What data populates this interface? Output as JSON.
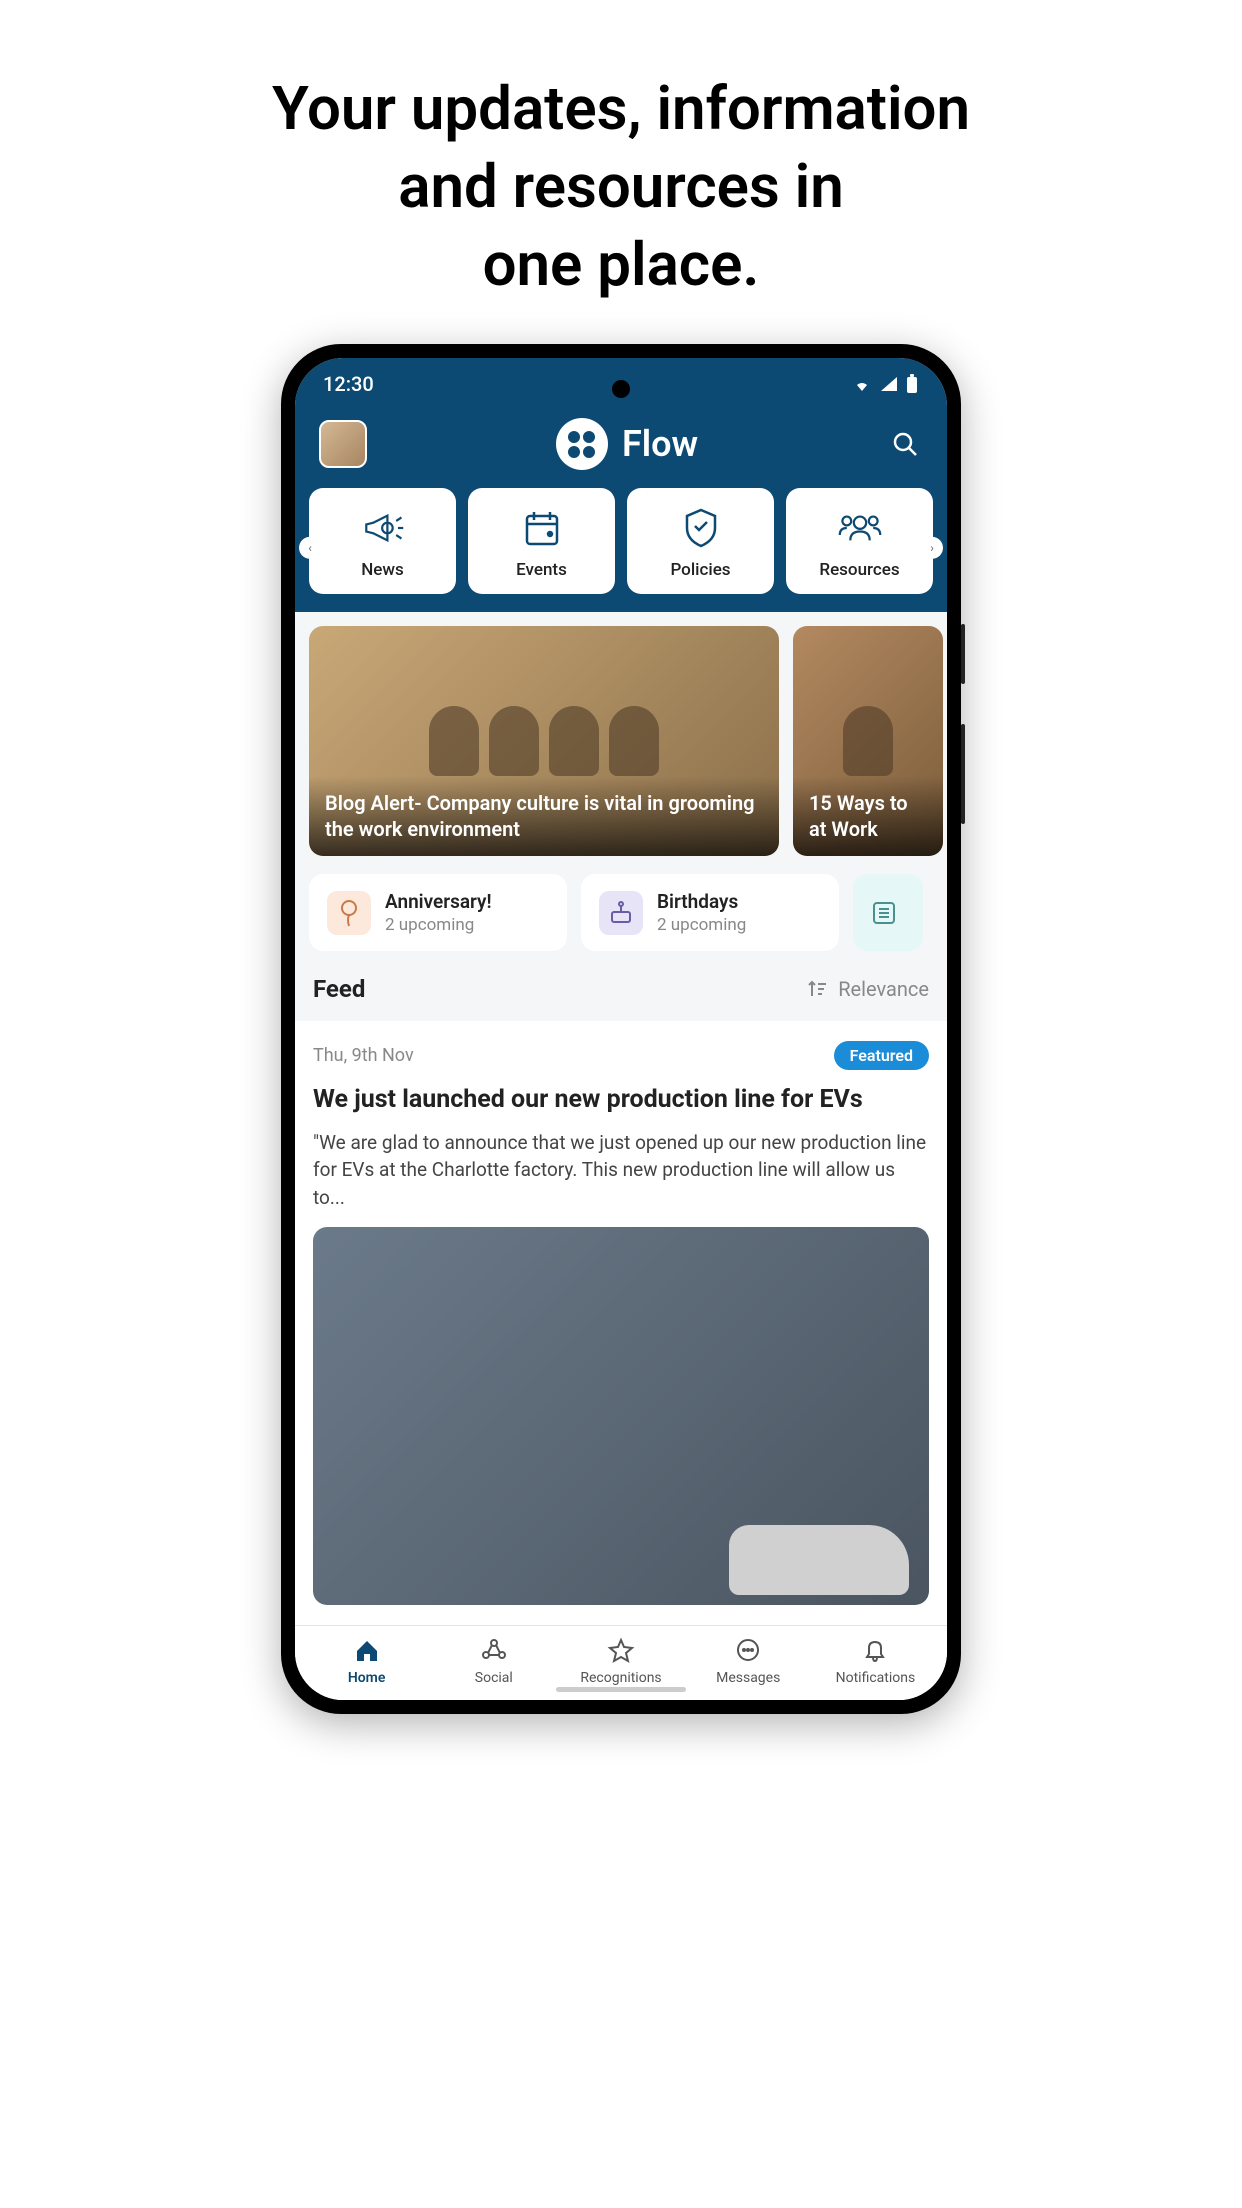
{
  "marketing": {
    "line1": "Your updates, information",
    "line2": "and resources in",
    "line3": "one place."
  },
  "status_bar": {
    "time": "12:30"
  },
  "header": {
    "app_name": "Flow"
  },
  "nav_cards": [
    {
      "label": "News"
    },
    {
      "label": "Events"
    },
    {
      "label": "Policies"
    },
    {
      "label": "Resources"
    }
  ],
  "hero": [
    {
      "title": "Blog Alert- Company culture is vital in grooming the work environment"
    },
    {
      "title": "15 Ways to at Work"
    }
  ],
  "widgets": [
    {
      "title": "Anniversary!",
      "sub": "2 upcoming"
    },
    {
      "title": "Birthdays",
      "sub": "2 upcoming"
    }
  ],
  "feed": {
    "heading": "Feed",
    "sort_label": "Relevance",
    "post": {
      "date": "Thu, 9th Nov",
      "badge": "Featured",
      "title": "We just launched our new production line for EVs",
      "body": "\"We are glad to announce that we just opened up our new production line for EVs at the Charlotte factory. This new production line will allow us to..."
    }
  },
  "bottom_nav": [
    {
      "label": "Home"
    },
    {
      "label": "Social"
    },
    {
      "label": "Recognitions"
    },
    {
      "label": "Messages"
    },
    {
      "label": "Notifications"
    }
  ]
}
